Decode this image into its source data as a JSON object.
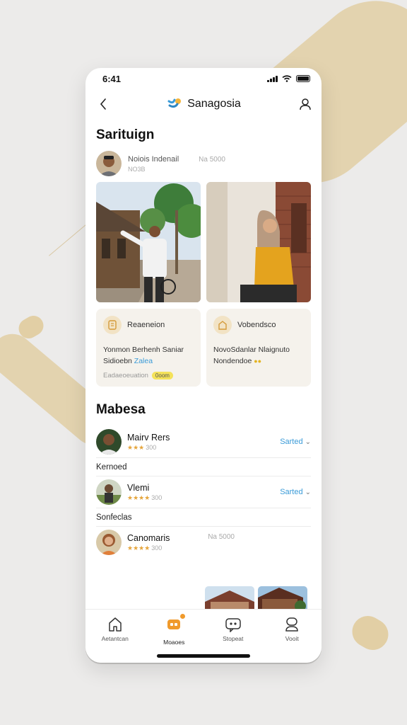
{
  "status": {
    "time": "6:41"
  },
  "header": {
    "app_name": "Sanagosia"
  },
  "section1": {
    "title": "Sarituign",
    "author": {
      "name": "Noiois Indenail",
      "sub": "NO3B",
      "meta": "Na 5000"
    }
  },
  "cards": [
    {
      "title": "Reaeneion",
      "body": "Yonmon Berhenh Saniar Sidioebn",
      "body_link": "Zalea",
      "foot": "Eadaeoeuation",
      "pill": "0oom"
    },
    {
      "title": "Vobendsco",
      "body": "NovoSdanlar Nlaignuto Nondendoe",
      "dots": "●●"
    }
  ],
  "section2": {
    "title": "Mabesa"
  },
  "people": [
    {
      "name": "Mairv Rers",
      "stars": "★★★",
      "count": "300",
      "action": "Sarted"
    },
    {
      "group": "Kernoed"
    },
    {
      "name": "Vlemi",
      "stars": "★★★★",
      "count": "300",
      "action": "Sarted"
    },
    {
      "group": "Sonfeclas"
    },
    {
      "name": "Canomaris",
      "stars": "★★★★",
      "count": "300",
      "meta": "Na 5000"
    }
  ],
  "tabs": [
    {
      "label": "Aetantcan",
      "icon": "home-icon"
    },
    {
      "label": "Moaoes",
      "icon": "messages-icon",
      "active": true
    },
    {
      "label": "Stopeat",
      "icon": "chat-icon"
    },
    {
      "label": "Vooit",
      "icon": "profile-icon"
    }
  ],
  "colors": {
    "accent": "#f09a2c",
    "link": "#3a9bd8",
    "beige": "#e2cfa5",
    "card": "#f5f2ec"
  }
}
